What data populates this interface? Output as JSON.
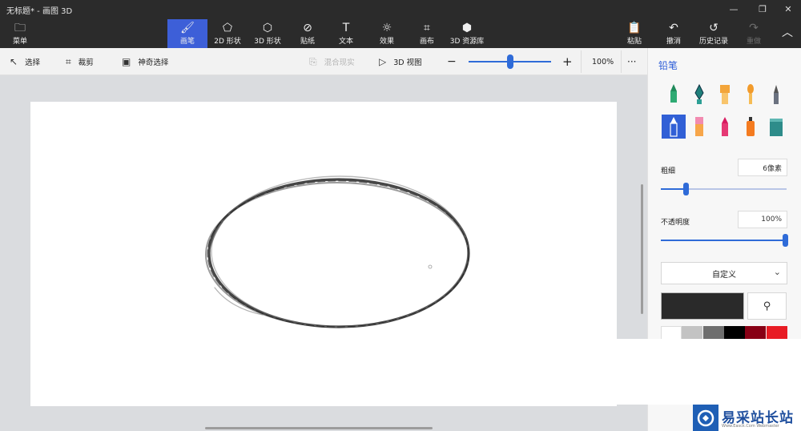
{
  "window": {
    "title": "无标题* - 画图 3D",
    "minimize_icon": "minimize-icon",
    "maximize_icon": "maximize-icon",
    "close_icon": "close-icon"
  },
  "ribbon": {
    "menu": "菜单",
    "brushes": "画笔",
    "shapes2d": "2D 形状",
    "shapes3d": "3D 形状",
    "stickers": "贴纸",
    "text": "文本",
    "effects": "效果",
    "canvas": "画布",
    "library3d": "3D 资源库",
    "paste": "粘贴",
    "undo": "撤消",
    "history": "历史记录",
    "redo": "重做"
  },
  "toolbar": {
    "select": "选择",
    "crop": "裁剪",
    "magic_select": "神奇选择",
    "mix_reality": "混合现实",
    "view3d": "3D 视图",
    "zoom_value": "100%",
    "more": "···",
    "zoom_minus": "−",
    "zoom_plus": "+",
    "zoom_level": 0.5
  },
  "panel": {
    "title": "铅笔",
    "thickness_label": "粗细",
    "thickness_value": "6像素",
    "thickness_fraction": 0.2,
    "opacity_label": "不透明度",
    "opacity_value": "100%",
    "opacity_fraction": 1.0,
    "preset": "自定义",
    "selected_color": "#2a2a2a",
    "swatches": [
      "#ffffff",
      "#c3c3c3",
      "#6e6e6e",
      "#000000",
      "#880015",
      "#e81c24"
    ]
  },
  "watermark": {
    "text": "易采站长站",
    "sub": "Www.Easck.Com  Webmaster"
  }
}
